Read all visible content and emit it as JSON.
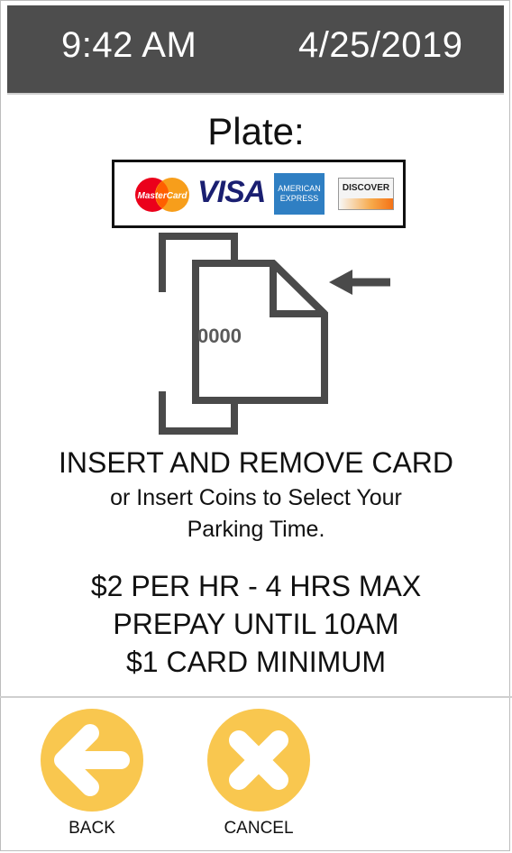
{
  "header": {
    "time": "9:42 AM",
    "date": "4/25/2019"
  },
  "plate_label": "Plate:",
  "card_logos": {
    "mastercard": "MasterCard",
    "visa": "VISA",
    "amex_line1": "AMERICAN",
    "amex_line2": "EXPRESS",
    "discover": "DISCOVER"
  },
  "card_number_fragment": "0000",
  "instructions": {
    "primary": "INSERT AND REMOVE CARD",
    "secondary_line1": "or Insert Coins to Select Your",
    "secondary_line2": "Parking Time."
  },
  "rates": [
    "$2 PER HR - 4 HRS MAX",
    "PREPAY UNTIL 10AM",
    "$1 CARD MINIMUM"
  ],
  "buttons": {
    "back": "BACK",
    "cancel": "CANCEL"
  },
  "colors": {
    "header_bg": "#4d4d4d",
    "button_yellow": "#f9c74f",
    "illustration_gray": "#4a4a4a"
  },
  "icons": {
    "back": "left-arrow-icon",
    "cancel": "x-icon"
  }
}
